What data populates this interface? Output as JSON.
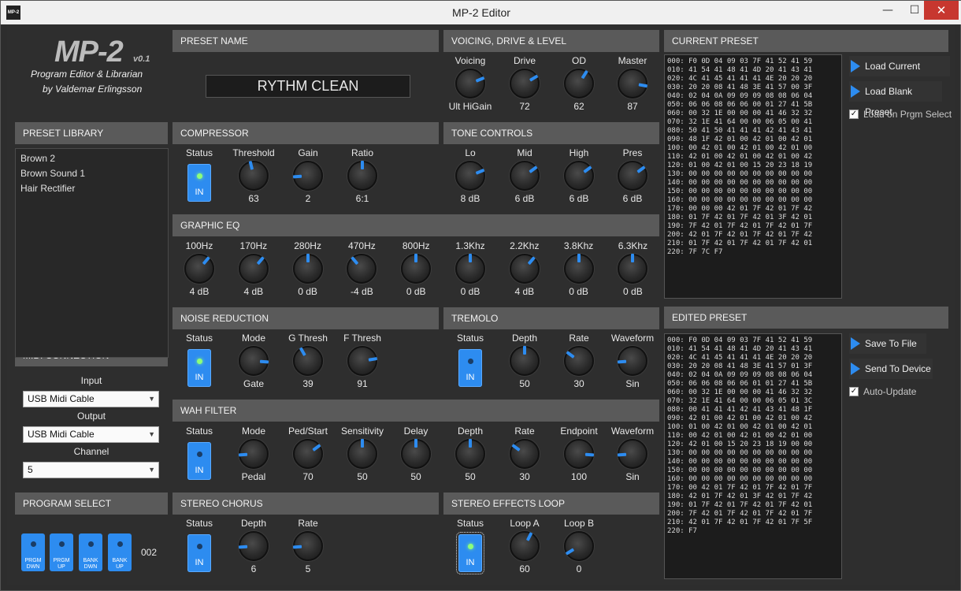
{
  "window": {
    "title": "MP-2 Editor",
    "icon_text": "MP-2",
    "minimize": "—",
    "maximize": "☐",
    "close": "✕"
  },
  "logo": {
    "title": "MP-2",
    "version": "v0.1",
    "subtitle1": "Program Editor & Librarian",
    "subtitle2": "by Valdemar Erlingsson"
  },
  "preset_name": {
    "header": "PRESET NAME",
    "value": "RYTHM CLEAN"
  },
  "voicing": {
    "header": "VOICING, DRIVE & LEVEL",
    "knobs": [
      {
        "label": "Voicing",
        "value": "Ult HiGain",
        "level": 0.75
      },
      {
        "label": "Drive",
        "value": "72",
        "level": 0.72
      },
      {
        "label": "OD",
        "value": "62",
        "level": 0.62
      },
      {
        "label": "Master",
        "value": "87",
        "level": 0.87
      }
    ]
  },
  "library": {
    "header": "PRESET LIBRARY",
    "items": [
      "Brown 2",
      "Brown Sound 1",
      "Hair Rectifier"
    ]
  },
  "compressor": {
    "header": "COMPRESSOR",
    "status_label": "Status",
    "status": "IN",
    "status_on": true,
    "knobs": [
      {
        "label": "Threshold",
        "value": "63",
        "level": 0.45
      },
      {
        "label": "Gain",
        "value": "2",
        "level": 0.15
      },
      {
        "label": "Ratio",
        "value": "6:1",
        "level": 0.5
      }
    ]
  },
  "tone": {
    "header": "TONE CONTROLS",
    "knobs": [
      {
        "label": "Lo",
        "value": "8 dB",
        "level": 0.75
      },
      {
        "label": "Mid",
        "value": "6 dB",
        "level": 0.7
      },
      {
        "label": "High",
        "value": "6 dB",
        "level": 0.7
      },
      {
        "label": "Pres",
        "value": "6 dB",
        "level": 0.7
      }
    ]
  },
  "geq": {
    "header": "GRAPHIC EQ",
    "bands": [
      {
        "label": "100Hz",
        "value": "4 dB",
        "level": 0.65
      },
      {
        "label": "170Hz",
        "value": "4 dB",
        "level": 0.65
      },
      {
        "label": "280Hz",
        "value": "0 dB",
        "level": 0.5
      },
      {
        "label": "470Hz",
        "value": "-4 dB",
        "level": 0.35
      },
      {
        "label": "800Hz",
        "value": "0 dB",
        "level": 0.5
      },
      {
        "label": "1.3Khz",
        "value": "0 dB",
        "level": 0.5
      },
      {
        "label": "2.2Khz",
        "value": "4 dB",
        "level": 0.65
      },
      {
        "label": "3.8Khz",
        "value": "0 dB",
        "level": 0.5
      },
      {
        "label": "6.3Khz",
        "value": "0 dB",
        "level": 0.5
      }
    ]
  },
  "noise": {
    "header": "NOISE REDUCTION",
    "status_label": "Status",
    "status": "IN",
    "status_on": true,
    "knobs": [
      {
        "label": "Mode",
        "value": "Gate",
        "level": 0.85
      },
      {
        "label": "G Thresh",
        "value": "39",
        "level": 0.39
      },
      {
        "label": "F Thresh",
        "value": "91",
        "level": 0.8
      }
    ]
  },
  "tremolo": {
    "header": "TREMOLO",
    "status_label": "Status",
    "status": "IN",
    "status_on": false,
    "knobs": [
      {
        "label": "Depth",
        "value": "50",
        "level": 0.5
      },
      {
        "label": "Rate",
        "value": "30",
        "level": 0.3
      },
      {
        "label": "Waveform",
        "value": "Sin",
        "level": 0.15
      }
    ]
  },
  "midi": {
    "header": "MIDI CONNECTION",
    "input_label": "Input",
    "input_value": "USB Midi Cable",
    "output_label": "Output",
    "output_value": "USB Midi Cable",
    "channel_label": "Channel",
    "channel_value": "5"
  },
  "wah": {
    "header": "WAH FILTER",
    "status_label": "Status",
    "status": "IN",
    "status_on": false,
    "knobs": [
      {
        "label": "Mode",
        "value": "Pedal",
        "level": 0.15
      },
      {
        "label": "Ped/Start",
        "value": "70",
        "level": 0.7
      },
      {
        "label": "Sensitivity",
        "value": "50",
        "level": 0.5
      },
      {
        "label": "Delay",
        "value": "50",
        "level": 0.5
      },
      {
        "label": "Depth",
        "value": "50",
        "level": 0.5
      },
      {
        "label": "Rate",
        "value": "30",
        "level": 0.3
      },
      {
        "label": "Endpoint",
        "value": "100",
        "level": 0.85
      },
      {
        "label": "Waveform",
        "value": "Sin",
        "level": 0.15
      }
    ]
  },
  "program": {
    "header": "PROGRAM SELECT",
    "number": "002",
    "buttons": [
      {
        "l1": "PRGM",
        "l2": "DWN"
      },
      {
        "l1": "PRGM",
        "l2": "UP"
      },
      {
        "l1": "BANK",
        "l2": "DWN"
      },
      {
        "l1": "BANK",
        "l2": "UP"
      }
    ]
  },
  "chorus": {
    "header": "STEREO CHORUS",
    "status_label": "Status",
    "status": "IN",
    "status_on": false,
    "knobs": [
      {
        "label": "Depth",
        "value": "6",
        "level": 0.15
      },
      {
        "label": "Rate",
        "value": "5",
        "level": 0.15
      }
    ]
  },
  "loop": {
    "header": "STEREO EFFECTS LOOP",
    "status_label": "Status",
    "status": "IN",
    "status_on": true,
    "knobs": [
      {
        "label": "Loop A",
        "value": "60",
        "level": 0.6
      },
      {
        "label": "Loop B",
        "value": "0",
        "level": 0.05
      }
    ]
  },
  "current": {
    "header": "CURRENT PRESET",
    "hex": "000: F0 0D 04 09 03 7F 41 52 41 59\n010: 41 54 41 48 41 4D 20 41 43 41\n020: 4C 41 45 41 41 41 4E 20 20 20\n030: 20 20 08 41 48 3E 41 57 00 3F\n040: 02 04 0A 09 09 09 08 08 06 04\n050: 06 06 08 06 06 00 01 27 41 5B\n060: 00 32 1E 00 00 00 41 46 32 32\n070: 32 1E 41 64 00 00 06 05 00 41\n080: 50 41 50 41 41 41 42 41 43 41\n090: 48 1F 42 01 00 42 01 00 42 01\n100: 00 42 01 00 42 01 00 42 01 00\n110: 42 01 00 42 01 00 42 01 00 42\n120: 01 00 42 01 00 15 20 23 18 19\n130: 00 00 00 00 00 00 00 00 00 00\n140: 00 00 00 00 00 00 00 00 00 00\n150: 00 00 00 00 00 00 00 00 00 00\n160: 00 00 00 00 00 00 00 00 00 00\n170: 00 00 00 42 01 7F 42 01 7F 42\n180: 01 7F 42 01 7F 42 01 3F 42 01\n190: 7F 42 01 7F 42 01 7F 42 01 7F\n200: 42 01 7F 42 01 7F 42 01 7F 42\n210: 01 7F 42 01 7F 42 01 7F 42 01\n220: 7F 7C F7",
    "btn_load_current": "Load Current Preset",
    "btn_load_blank": "Load Blank Preset",
    "chk_label": "Load on Prgm Select",
    "chk_checked": "✓"
  },
  "edited": {
    "header": "EDITED PRESET",
    "hex": "000: F0 0D 04 09 03 7F 41 52 41 59\n010: 41 54 41 48 41 4D 20 41 43 41\n020: 4C 41 45 41 41 41 4E 20 20 20\n030: 20 20 08 41 48 3E 41 57 01 3F\n040: 02 04 0A 09 09 09 08 08 06 04\n050: 06 06 08 06 06 01 01 27 41 5B\n060: 00 32 1E 00 00 00 41 46 32 32\n070: 32 1E 41 64 00 00 06 05 01 3C\n080: 00 41 41 41 42 41 43 41 48 1F\n090: 42 01 00 42 01 00 42 01 00 42\n100: 01 00 42 01 00 42 01 00 42 01\n110: 00 42 01 00 42 01 00 42 01 00\n120: 42 01 00 15 20 23 18 19 00 00\n130: 00 00 00 00 00 00 00 00 00 00\n140: 00 00 00 00 00 00 00 00 00 00\n150: 00 00 00 00 00 00 00 00 00 00\n160: 00 00 00 00 00 00 00 00 00 00\n170: 00 42 01 7F 42 01 7F 42 01 7F\n180: 42 01 7F 42 01 3F 42 01 7F 42\n190: 01 7F 42 01 7F 42 01 7F 42 01\n200: 7F 42 01 7F 42 01 7F 42 01 7F\n210: 42 01 7F 42 01 7F 42 01 7F 5F\n220: F7",
    "btn_save": "Save To File",
    "btn_send": "Send To Device",
    "chk_label": "Auto-Update",
    "chk_checked": "✓"
  },
  "colors": {
    "accent": "#2d8cf0",
    "header_bg": "#5a5a5a",
    "panel_bg": "#2e2e2e",
    "led_on": "#8cff7a",
    "close_btn": "#c7372f"
  }
}
